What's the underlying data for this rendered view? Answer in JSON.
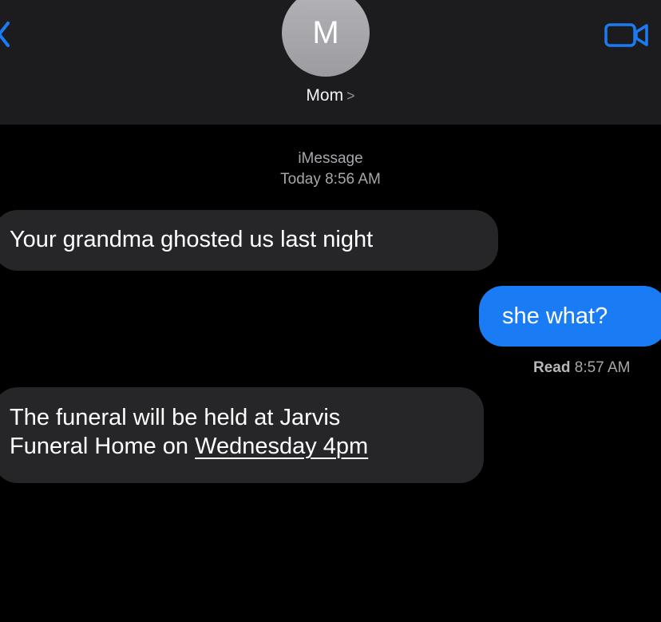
{
  "header": {
    "avatar_initial": "M",
    "contact_name": "Mom",
    "contact_chevron": ">",
    "back_icon": "chevron-left-icon",
    "video_icon": "video-camera-icon"
  },
  "conversation": {
    "service": "iMessage",
    "timestamp": "Today 8:56 AM",
    "messages": [
      {
        "direction": "incoming",
        "text": "Your grandma ghosted us last night"
      },
      {
        "direction": "outgoing",
        "text": "she what?"
      },
      {
        "direction": "incoming",
        "line1": "The funeral will be held at Jarvis",
        "line2_prefix": "Funeral Home on ",
        "line2_link": "Wednesday 4pm"
      }
    ],
    "read_receipt": {
      "label": "Read",
      "time": "8:57 AM"
    }
  },
  "colors": {
    "background": "#000000",
    "header_background": "#1c1c1e",
    "incoming_bubble": "#262628",
    "outgoing_bubble": "#1a7cf5",
    "accent": "#1a7cf5"
  }
}
